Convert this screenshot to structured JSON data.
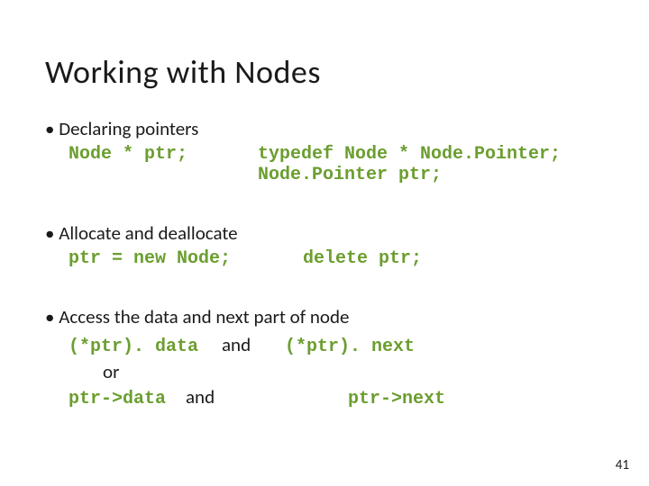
{
  "title": "Working with Nodes",
  "bullets": {
    "declaring": "• Declaring pointers",
    "allocate": "• Allocate and deallocate",
    "access": "• Access the data and next part of node"
  },
  "code": {
    "decl_left": "Node * ptr;",
    "decl_right_l1": "typedef Node * Node.Pointer;",
    "decl_right_l2": "Node.Pointer ptr;",
    "alloc_left": "ptr = new Node;",
    "alloc_right": "delete ptr;",
    "acc1_left": "(*ptr). data",
    "acc1_right": "(*ptr). next",
    "acc2_left": "ptr->data",
    "acc2_right": "ptr->next"
  },
  "words": {
    "and": "and",
    "or": "or"
  },
  "page_number": "41"
}
